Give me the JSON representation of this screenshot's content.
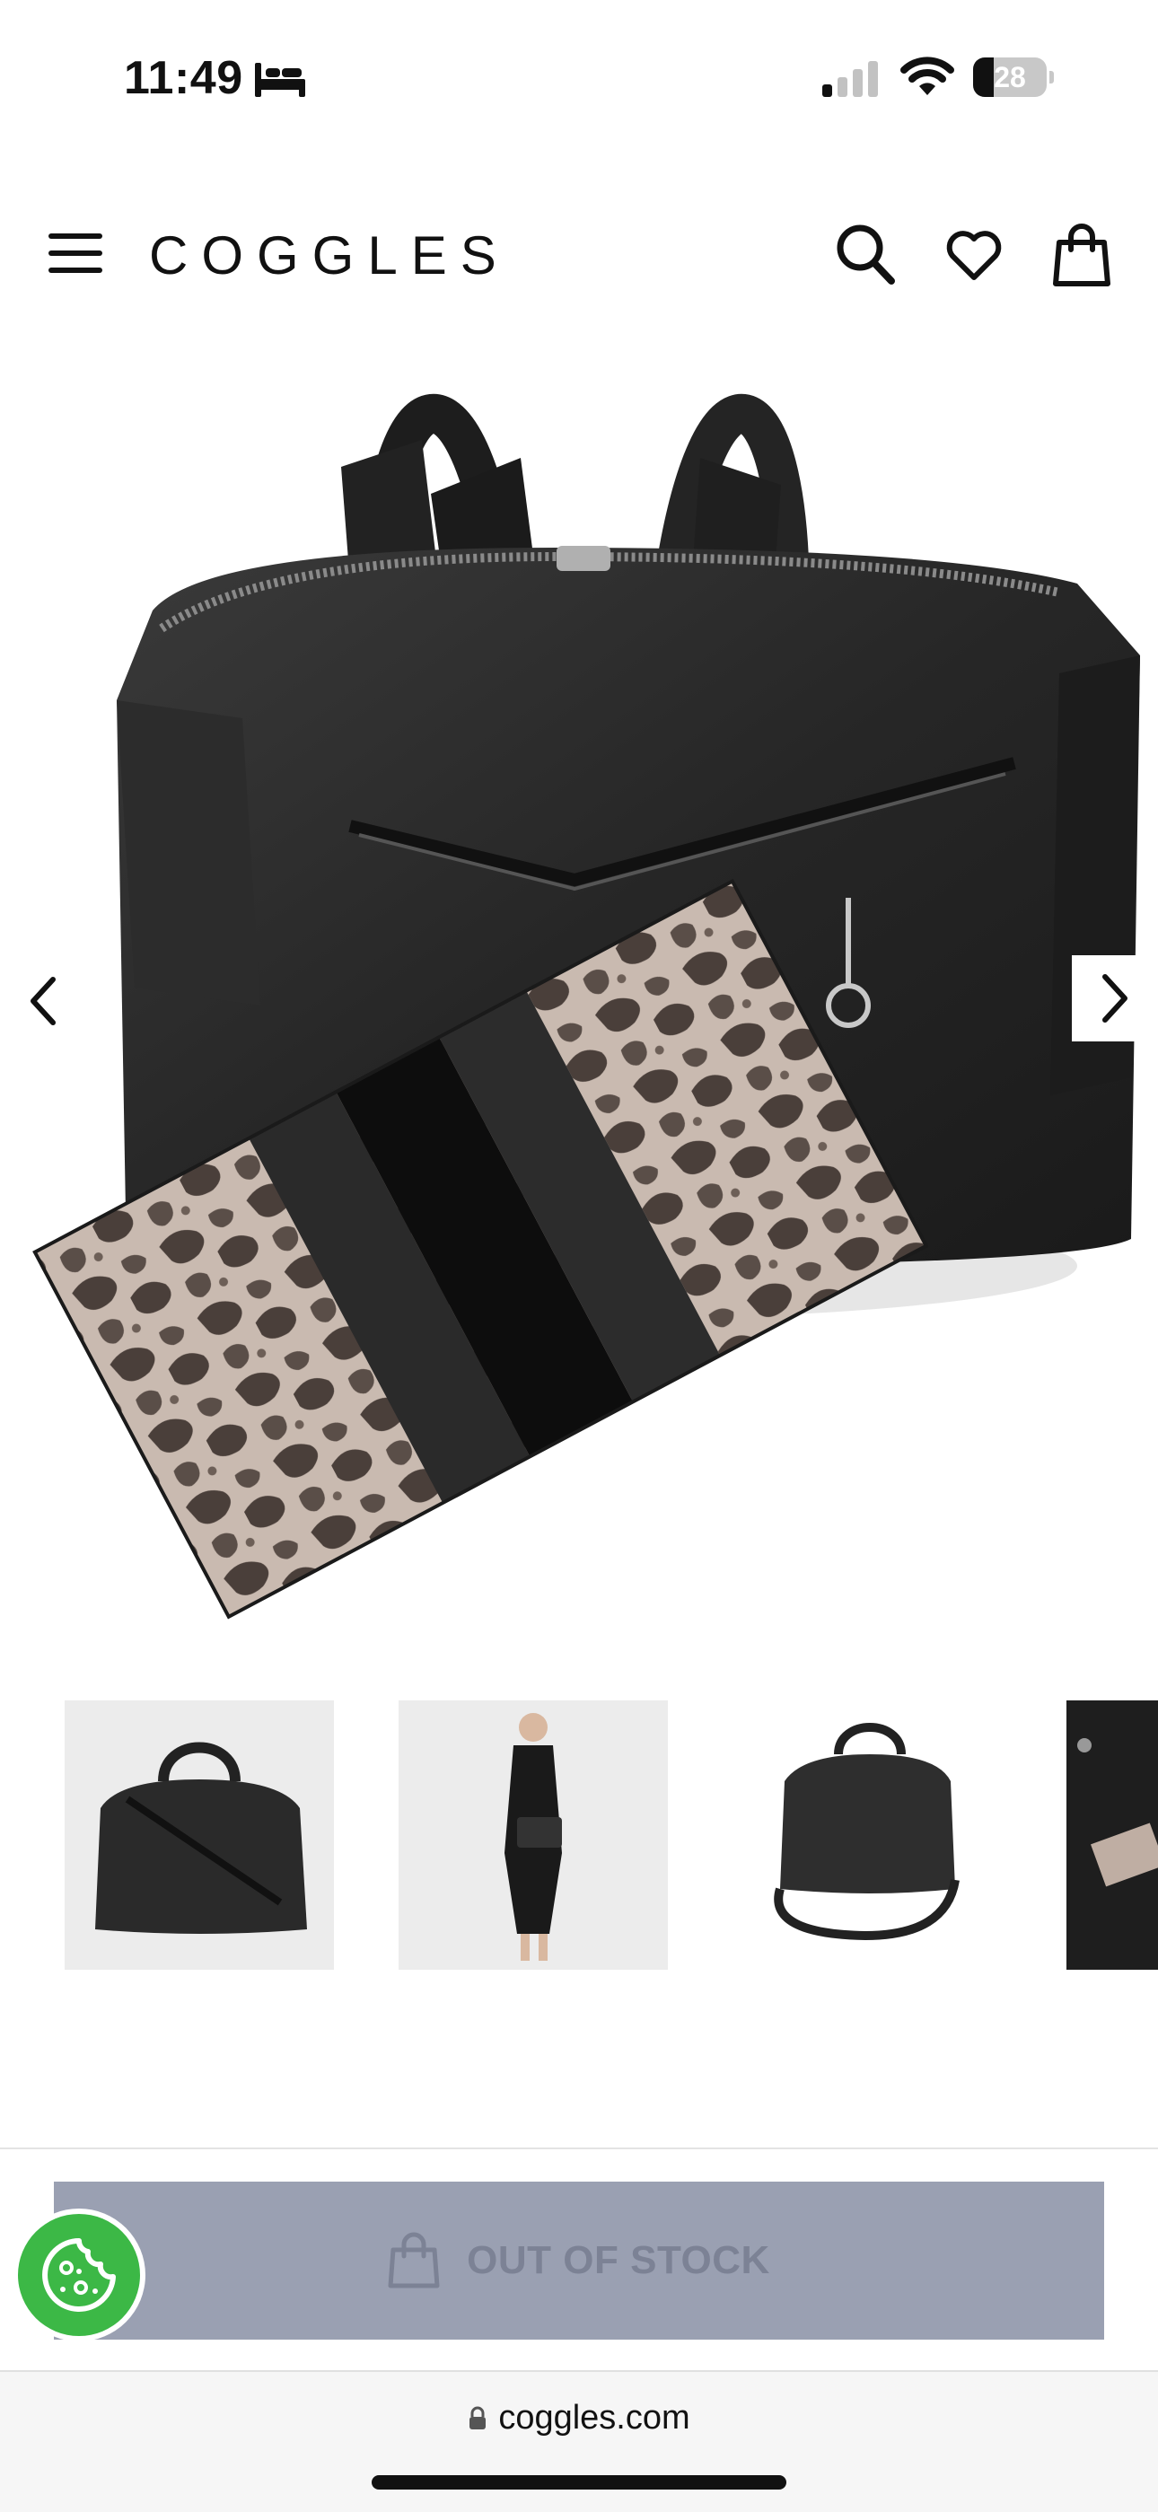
{
  "status_bar": {
    "time": "11:49",
    "focus_icon": "bed-icon",
    "battery_level": "28",
    "battery_fraction": 0.28
  },
  "header": {
    "brand": "COGGLES",
    "icons": [
      "menu-icon",
      "search-icon",
      "heart-icon",
      "shopping-bag-icon"
    ]
  },
  "gallery": {
    "main_image": "black leather bowling bag with snakeskin-print pouch",
    "thumbnails": [
      "black leather bag with strap",
      "model in black dress holding bag",
      "black bag with shoulder strap",
      "bag with snakeskin pouch (cropped)"
    ]
  },
  "product": {
    "stock_button_label": "OUT OF STOCK"
  },
  "browser": {
    "url": "coggles.com"
  },
  "colors": {
    "accent_green": "#3cb846",
    "disabled_button": "#9aa0b2",
    "disabled_text": "#7c8295"
  }
}
